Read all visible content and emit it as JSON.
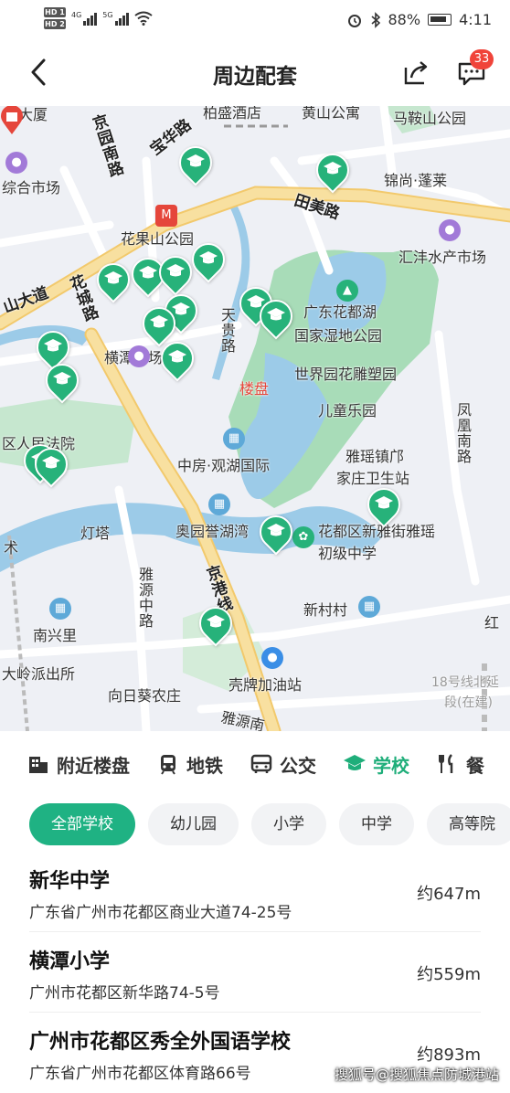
{
  "status_bar": {
    "hd1": "HD 1",
    "hd2": "HD 2",
    "net1": "4G",
    "net2": "5G",
    "battery_pct": "88%",
    "time": "4:11"
  },
  "header": {
    "title": "周边配套",
    "badge_count": "33"
  },
  "map": {
    "labels": {
      "l1": "桥大厦",
      "l2": "柏盛酒店",
      "l3": "黄山公寓",
      "l4": "马鞍山公园",
      "l5": "综合市场",
      "l6": "锦尚·蓬莱",
      "l7": "田美路",
      "l8": "花果山公园",
      "l9": "汇沣水产市场",
      "l10": "山大道",
      "l11": "花城路",
      "l12": "广东花都湖",
      "l13": "国家湿地公园",
      "l14": "天贵路",
      "l15": "横潭市场",
      "l16": "楼盘",
      "l17": "世界园花雕塑园",
      "l18": "儿童乐园",
      "l19": "凤凰南路",
      "l20": "区人民法院",
      "l21": "中房·观湖国际",
      "l22": "雅瑶镇邝",
      "l23": "家庄卫生站",
      "l24": "灯塔",
      "l25": "奥园誉湖湾",
      "l26": "花都区新雅街雅瑶",
      "l27": "初级中学",
      "l28": "京港线",
      "l29": "雅源中路",
      "l30": "新村村",
      "l31": "南兴里",
      "l32": "红",
      "l33": "大岭派出所",
      "l34": "向日葵农庄",
      "l35": "壳牌加油站",
      "l36": "雅源南",
      "l37": "18号线北延",
      "l38": "段(在建)",
      "l39": "术",
      "l40": "宝华路",
      "l41": "京园南路"
    }
  },
  "tabs": [
    {
      "label": "附近楼盘",
      "icon": "building-icon"
    },
    {
      "label": "地铁",
      "icon": "metro-icon"
    },
    {
      "label": "公交",
      "icon": "bus-icon"
    },
    {
      "label": "学校",
      "icon": "graduation-cap-icon"
    },
    {
      "label": "餐",
      "icon": "restaurant-icon"
    }
  ],
  "chips": [
    "全部学校",
    "幼儿园",
    "小学",
    "中学",
    "高等院"
  ],
  "schools": [
    {
      "name": "新华中学",
      "address": "广东省广州市花都区商业大道74-25号",
      "distance": "约647m"
    },
    {
      "name": "横潭小学",
      "address": "广州市花都区新华路74-5号",
      "distance": "约559m"
    },
    {
      "name": "广州市花都区秀全外国语学校",
      "address": "广东省广州市花都区体育路66号",
      "distance": "约893m"
    }
  ],
  "watermark": "搜狐号@搜狐焦点防城港站",
  "colors": {
    "accent": "#1fae7a",
    "badge": "#f0443a",
    "park": "#a8dcb8",
    "water": "#9ccbe8",
    "main_road": "#f5d98a"
  }
}
